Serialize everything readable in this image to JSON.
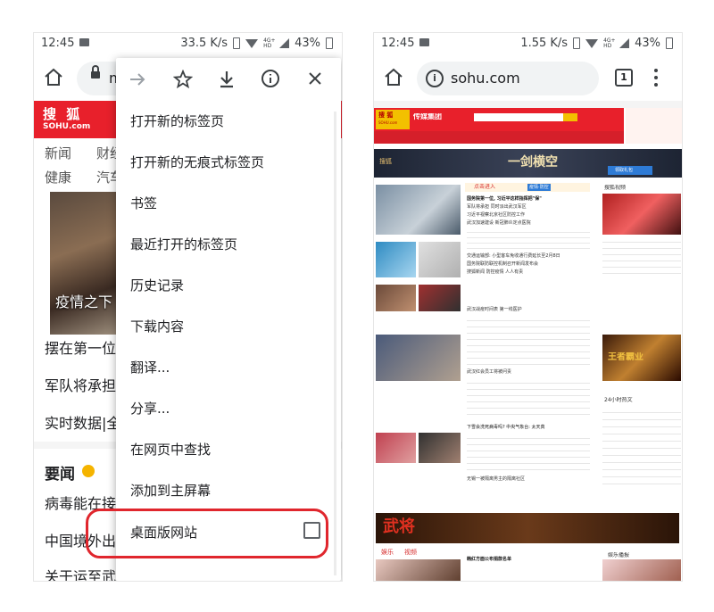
{
  "left_phone": {
    "status": {
      "time": "12:45",
      "speed": "33.5 K/s",
      "battery": "43%",
      "net_label": "4G+ HD"
    },
    "address_bar": {
      "url_partial": "m"
    },
    "page": {
      "logo_cn": "搜 狐",
      "logo_en": "SOHU.com",
      "nav_row1": [
        "新闻",
        "财经"
      ],
      "nav_row2": [
        "健康",
        "汽车"
      ],
      "hero_caption": "疫情之下",
      "headlines": [
        "摆在第一位",
        "军队将承担",
        "实时数据|全"
      ],
      "section_title": "要闻",
      "section_lines": [
        "病毒能在接",
        "中国境外出",
        "关于运至武汉物资数量及标准 工信部回应"
      ]
    },
    "menu": {
      "icons": [
        "forward-icon",
        "star-icon",
        "download-icon",
        "info-icon",
        "close-icon"
      ],
      "items": [
        "打开新的标签页",
        "打开新的无痕式标签页",
        "书签",
        "最近打开的标签页",
        "历史记录",
        "下载内容",
        "翻译...",
        "分享...",
        "在网页中查找",
        "添加到主屏幕",
        "桌面版网站"
      ],
      "desktop_site_checked": false,
      "highlight_color": "#e0262d"
    }
  },
  "right_phone": {
    "status": {
      "time": "12:45",
      "speed": "1.55 K/s",
      "battery": "43%",
      "net_label": "4G+ HD"
    },
    "address_bar": {
      "url": "sohu.com",
      "tab_count": "1"
    },
    "page": {
      "logo_cn": "搜 狐",
      "logo_en": "SOHU.com",
      "logo_sub": "传媒集团",
      "banner1": "一剑横空",
      "banner1_sub": "领取礼包",
      "left_tag": "搜狐",
      "news_header": "点击进入",
      "news_tag": "疫情·防控",
      "lines": [
        "国务院第一位, 习近平这样指挥把\"保\"",
        "军队将承担 同时派出武汉军区",
        "习近平视察北京社区防控工作",
        "武汉加速建设 新冠肺炎定点医院",
        "交通运输部: 小型客车免收通行费延长至2月8日",
        "国务院联防联控机制召开新闻发布会",
        "搜狐新闻 防控疫情 人人有责",
        "武汉战疫时间表 第一线医护",
        "武汉红会员工将被问责",
        "下雪会洗死病毒吗? 中央气象台: 太天真",
        "无锡一被隔离男主的隔离社区",
        "韩红方面公布捐款名单"
      ],
      "banner2": "王者霸业",
      "banner3": "武将",
      "tabs": [
        "娱乐",
        "视频"
      ],
      "right_section": "搜狐视频",
      "right_section2": "24小时热文",
      "right_section3": "娱乐播报",
      "accent": "#e8202b"
    }
  }
}
